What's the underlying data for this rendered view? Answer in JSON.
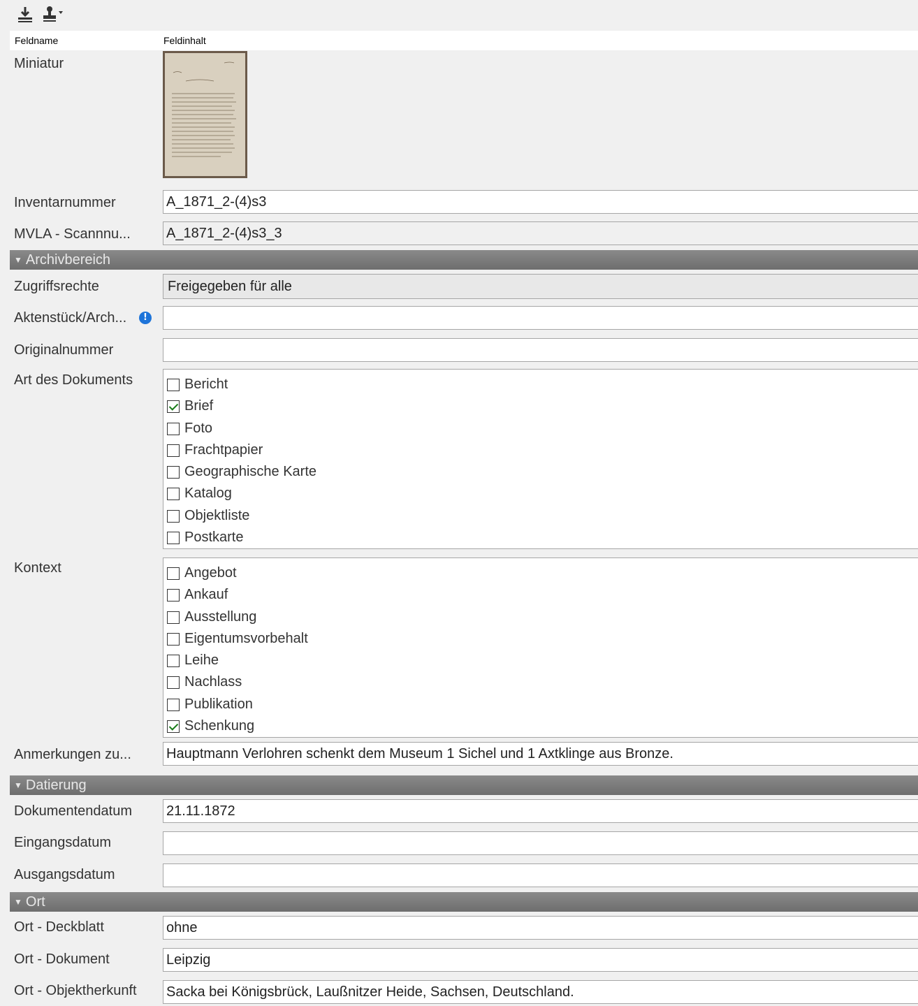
{
  "toolbar": {
    "export_icon": "download-tray-icon",
    "stamp_icon": "stamp-dropdown-icon"
  },
  "header": {
    "fieldname": "Feldname",
    "fieldcontent": "Feldinhalt"
  },
  "fields": {
    "miniatur": {
      "label": "Miniatur"
    },
    "inventarnummer": {
      "label": "Inventarnummer",
      "value": "A_1871_2-(4)s3"
    },
    "scannummer": {
      "label": "MVLA - Scannnu...",
      "value": "A_1871_2-(4)s3_3"
    }
  },
  "sections": {
    "archiv": "Archivbereich",
    "datierung": "Datierung",
    "ort": "Ort"
  },
  "archiv": {
    "zugriffsrechte": {
      "label": "Zugriffsrechte",
      "value": "Freigegeben für alle"
    },
    "aktenstueck": {
      "label": "Aktenstück/Arch...",
      "value": ""
    },
    "originalnummer": {
      "label": "Originalnummer",
      "value": ""
    },
    "art": {
      "label": "Art des Dokuments",
      "options": [
        {
          "label": "Bericht",
          "checked": false
        },
        {
          "label": "Brief",
          "checked": true
        },
        {
          "label": "Foto",
          "checked": false
        },
        {
          "label": "Frachtpapier",
          "checked": false
        },
        {
          "label": "Geographische Karte",
          "checked": false
        },
        {
          "label": "Katalog",
          "checked": false
        },
        {
          "label": "Objektliste",
          "checked": false
        },
        {
          "label": "Postkarte",
          "checked": false
        }
      ]
    },
    "kontext": {
      "label": "Kontext",
      "options": [
        {
          "label": "Angebot",
          "checked": false
        },
        {
          "label": "Ankauf",
          "checked": false
        },
        {
          "label": "Ausstellung",
          "checked": false
        },
        {
          "label": "Eigentumsvorbehalt",
          "checked": false
        },
        {
          "label": "Leihe",
          "checked": false
        },
        {
          "label": "Nachlass",
          "checked": false
        },
        {
          "label": "Publikation",
          "checked": false
        },
        {
          "label": "Schenkung",
          "checked": true
        }
      ]
    },
    "anmerkungen": {
      "label": "Anmerkungen zu...",
      "value": "Hauptmann Verlohren schenkt dem Museum 1 Sichel und 1 Axtklinge aus Bronze."
    }
  },
  "datierung": {
    "dokumentendatum": {
      "label": "Dokumentendatum",
      "value": "21.11.1872"
    },
    "eingangsdatum": {
      "label": "Eingangsdatum",
      "value": ""
    },
    "ausgangsdatum": {
      "label": "Ausgangsdatum",
      "value": ""
    }
  },
  "ort": {
    "deckblatt": {
      "label": "Ort - Deckblatt",
      "value": "ohne"
    },
    "dokument": {
      "label": "Ort - Dokument",
      "value": "Leipzig"
    },
    "objektherkunft": {
      "label": "Ort - Objektherkunft",
      "value": "Sacka bei Königsbrück, Laußnitzer Heide, Sachsen, Deutschland."
    }
  },
  "colors": {
    "section_bg": "#7a7a7a",
    "info_blue": "#1e74d9",
    "check_green": "#1a7d1a"
  }
}
